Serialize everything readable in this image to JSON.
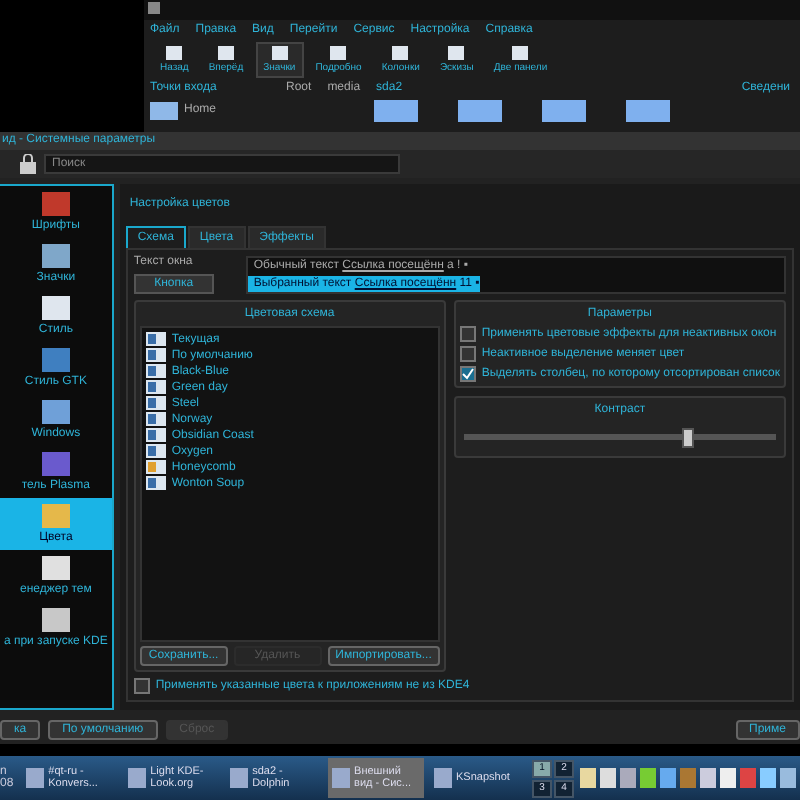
{
  "dolphin": {
    "menu": [
      "Файл",
      "Правка",
      "Вид",
      "Перейти",
      "Сервис",
      "Настройка",
      "Справка"
    ],
    "toolbar": [
      {
        "label": "Назад",
        "selected": false
      },
      {
        "label": "Вперёд",
        "selected": false
      },
      {
        "label": "Значки",
        "selected": true
      },
      {
        "label": "Подробно",
        "selected": false
      },
      {
        "label": "Колонки",
        "selected": false
      },
      {
        "label": "Эскизы",
        "selected": false
      },
      {
        "label": "Две панели",
        "selected": false
      }
    ],
    "places_title": "Точки входа",
    "places": [
      "Home"
    ],
    "breadcrumb": [
      "Root",
      "media",
      "sda2"
    ],
    "info_title": "Сведени"
  },
  "window": {
    "title": "ид - Системные параметры",
    "search_label": "Поиск"
  },
  "sidebar": {
    "items": [
      {
        "label": "Шрифты",
        "selected": false
      },
      {
        "label": "Значки",
        "selected": false
      },
      {
        "label": "Стиль",
        "selected": false
      },
      {
        "label": "Стиль GTK",
        "selected": false
      },
      {
        "label": "Windows",
        "selected": false
      },
      {
        "label": "тель Plasma",
        "selected": false
      },
      {
        "label": "Цвета",
        "selected": true
      },
      {
        "label": "енеджер тем",
        "selected": false
      },
      {
        "label": "а при запуске KDE",
        "selected": false
      }
    ]
  },
  "panel": {
    "title": "Настройка цветов",
    "tabs": [
      {
        "label": "Схема",
        "selected": true
      },
      {
        "label": "Цвета",
        "selected": false
      },
      {
        "label": "Эффекты",
        "selected": false
      }
    ],
    "preview": {
      "label": "Текст окна",
      "button": "Кнопка",
      "lines": [
        {
          "text": "Обычный текст",
          "link": "Ссылка посещённ",
          "tail": "a ! ▪",
          "selected": false
        },
        {
          "text": "Выбранный текст",
          "link": "Ссылка посещённ",
          "tail": "11 ▪",
          "selected": true
        }
      ]
    },
    "schemes": {
      "title": "Цветовая схема",
      "items": [
        "Текущая",
        "По умолчанию",
        "Black-Blue",
        "Green day",
        "Steel",
        "Norway",
        "Obsidian Coast",
        "Oxygen",
        "Honeycomb",
        "Wonton Soup"
      ],
      "buttons": [
        {
          "label": "Сохранить...",
          "disabled": false
        },
        {
          "label": "Удалить",
          "disabled": true
        },
        {
          "label": "Импортировать...",
          "disabled": false
        }
      ]
    },
    "options": {
      "title": "Параметры",
      "items": [
        {
          "label": "Применять цветовые эффекты для неактивных окон",
          "checked": false
        },
        {
          "label": "Неактивное выделение меняет цвет",
          "checked": false
        },
        {
          "label": "Выделять столбец, по которому отсортирован список",
          "checked": true
        }
      ]
    },
    "contrast": {
      "title": "Контраст",
      "level": 0.72
    },
    "apply_non_kde": {
      "label": "Применять указанные цвета к приложениям не из KDE4",
      "checked": false
    }
  },
  "footer": {
    "buttons": [
      {
        "label": "ка",
        "disabled": false
      },
      {
        "label": "По умолчанию",
        "disabled": false
      },
      {
        "label": "Сброс",
        "disabled": true
      },
      {
        "label": "Приме",
        "disabled": false
      }
    ]
  },
  "taskbar": {
    "clock": "n 08",
    "tasks": [
      {
        "label": "#qt-ru - Konvers...",
        "selected": false
      },
      {
        "label": "Light KDE- Look.org",
        "selected": false
      },
      {
        "label": "sda2 - Dolphin",
        "selected": false
      },
      {
        "label": "Внешний вид - Сис...",
        "selected": true
      },
      {
        "label": "KSnapshot",
        "selected": false
      }
    ],
    "pager": [
      {
        "label": "1",
        "selected": true
      },
      {
        "label": "2",
        "selected": false
      },
      {
        "label": "3",
        "selected": false
      },
      {
        "label": "4",
        "selected": false
      }
    ]
  }
}
